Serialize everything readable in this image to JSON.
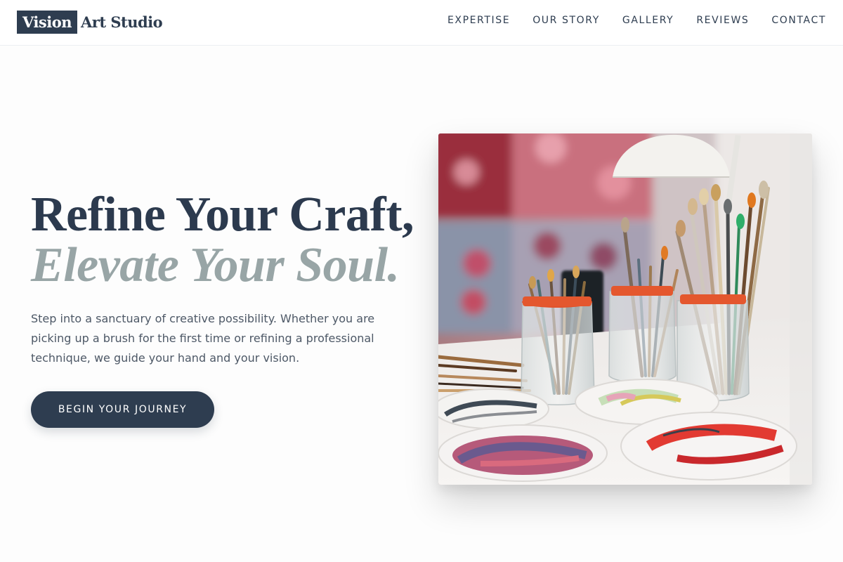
{
  "brand": {
    "logo_box": "Vision",
    "logo_text": "Art Studio"
  },
  "nav": {
    "items": [
      {
        "label": "EXPERTISE"
      },
      {
        "label": "OUR STORY"
      },
      {
        "label": "GALLERY"
      },
      {
        "label": "REVIEWS"
      },
      {
        "label": "CONTACT"
      }
    ]
  },
  "hero": {
    "title_line1": "Refine Your Craft,",
    "title_line2": "Elevate Your Soul.",
    "description": "Step into a sanctuary of creative possibility. Whether you are picking up a brush for the first time or refining a professional technique, we guide your hand and your vision.",
    "cta_label": "BEGIN YOUR JOURNEY",
    "image_alt": "Paint brushes in glass jars with paint palettes"
  },
  "colors": {
    "brand_navy": "#2e3d50",
    "accent_sage": "#98a5a6",
    "body_text": "#4d5866"
  }
}
